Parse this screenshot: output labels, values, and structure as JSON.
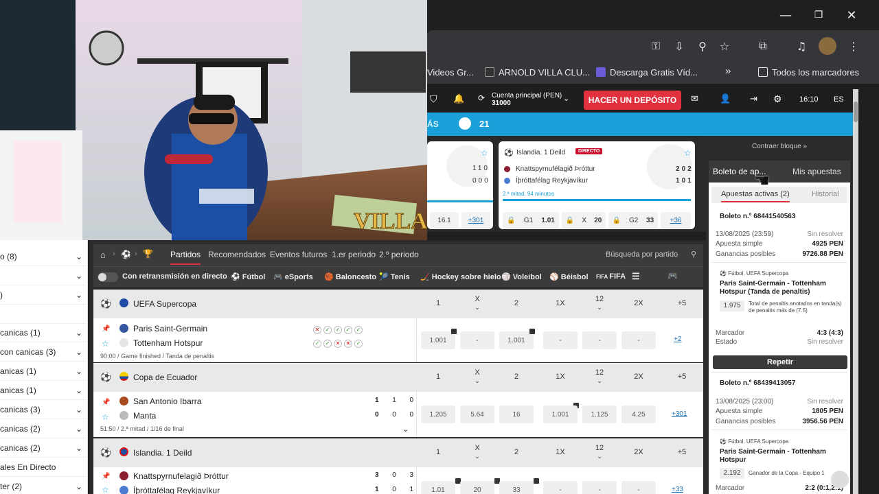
{
  "window": {
    "minimize": "—",
    "restore": "❐",
    "close": "✕"
  },
  "bookmarks": [
    {
      "label": "Videos Gr..."
    },
    {
      "label": "ARNOLD VILLA CLU..."
    },
    {
      "label": "Descarga Gratis Víd..."
    },
    {
      "label": "»"
    },
    {
      "label": "Todos los marcadores"
    }
  ],
  "site_header": {
    "account_label": "Cuenta principal (PEN)",
    "account_value": "31000",
    "deposit_button": "HACER UN DEPÓSITO",
    "time": "16:10",
    "lang": "ES"
  },
  "sports_bar": {
    "more": "ÁS",
    "count": "21"
  },
  "cards": [
    {
      "score_rows": [
        [
          "1",
          "1",
          "0"
        ],
        [
          "0",
          "0",
          "0"
        ]
      ],
      "odds": [
        "16.1",
        "+301"
      ]
    },
    {
      "league": "Islandia. 1 Deild",
      "live_badge": "DIRECTO",
      "team1": "Knattspyrnufélagið Þróttur",
      "team2": "Íþróttafélag Reykjavíkur",
      "score_rows": [
        [
          "2",
          "0",
          "2"
        ],
        [
          "1",
          "0",
          "1"
        ]
      ],
      "status": "2.ª mitad, 94 minutos",
      "odds": [
        {
          "k": "G1",
          "v": "1.01"
        },
        {
          "k": "X",
          "v": "20"
        },
        {
          "k": "G2",
          "v": "33"
        }
      ],
      "more": "+36"
    }
  ],
  "right_panel": {
    "collapse": "Contraer bloque »",
    "tab_slip": "Boleto de ap...",
    "tab_mybets": "Mis apuestas",
    "sub_active": "Apuestas activas (2)",
    "sub_history": "Historial",
    "tickets": [
      {
        "title": "Boleto n.º 68441540563",
        "date": "13/08/2025 (23:59)",
        "status": "Sin resolver",
        "type_label": "Apuesta simple",
        "stake": "4925 PEN",
        "gain_label": "Ganancias posibles",
        "gain": "9726.88 PEN",
        "sport": "Fútbol. UEFA Supercopa",
        "event": "Paris Saint-Germain - Tottenham Hotspur (Tanda de penaltis)",
        "odd": "1.975",
        "selection": "Total de penaltis anotados en tanda(s) de penaltis más de (7.5)",
        "score_label": "Marcador",
        "score": "4:3 (4:3)",
        "state_label": "Estado",
        "state": "Sin resolver",
        "repeat": "Repetir"
      },
      {
        "title": "Boleto n.º 68439413057",
        "date": "13/08/2025 (23:00)",
        "status": "Sin resolver",
        "type_label": "Apuesta simple",
        "stake": "1805 PEN",
        "gain_label": "Ganancias posibles",
        "gain": "3956.56 PEN",
        "sport": "Fútbol. UEFA Supercopa",
        "event": "Paris Saint-Germain - Tottenham Hotspur",
        "odd": "2.192",
        "selection": "Ganador de la Copa - Equipo 1",
        "score_label": "Marcador",
        "score": "2:2 (0:1,2:1)"
      }
    ]
  },
  "sidebar": [
    {
      "label": "o (8)"
    },
    {
      "label": ""
    },
    {
      "label": ")"
    },
    {
      "label": ""
    },
    {
      "label": " canicas (1)"
    },
    {
      "label": " con canicas (3)"
    },
    {
      "label": "anicas (1)"
    },
    {
      "label": "anicas (1)"
    },
    {
      "label": "canicas (3)"
    },
    {
      "label": "canicas (2)"
    },
    {
      "label": " canicas (2)"
    },
    {
      "label": "ales En Directo"
    },
    {
      "label": "ter (2)"
    }
  ],
  "tabs": {
    "active": "Partidos",
    "items": [
      "Recomendados",
      "Eventos futuros",
      "1.er periodo",
      "2.º periodo"
    ],
    "search_placeholder": "Búsqueda por partido"
  },
  "sports_filter": {
    "live_toggle": "Con retransmisión en directo",
    "items": [
      "Fútbol",
      "eSports",
      "Baloncesto",
      "Tenis",
      "Hockey sobre hielo",
      "Voleibol",
      "Béisbol",
      "FIFA"
    ]
  },
  "columns": [
    "1",
    "X",
    "2",
    "1X",
    "12",
    "2X",
    "+5"
  ],
  "leagues": [
    {
      "name": "UEFA Supercopa",
      "team1": "Paris Saint-Germain",
      "team2": "Tottenham Hotspur",
      "info": "90:00 / Game finished / Tanda de penaltis",
      "odds": [
        "1.001",
        "-",
        "1.001",
        "-",
        "-",
        "-"
      ],
      "more": "+2"
    },
    {
      "name": "Copa de Ecuador",
      "team1": "San Antonio Ibarra",
      "team2": "Manta",
      "score1": [
        "1",
        "1",
        "0"
      ],
      "score2": [
        "0",
        "0",
        "0"
      ],
      "info": "51:50 / 2.ª mitad / 1/16 de final",
      "odds": [
        "1.205",
        "5.64",
        "16",
        "1.001",
        "1.125",
        "4.25"
      ],
      "more": "+301"
    },
    {
      "name": "Islandia. 1 Deild",
      "team1": "Knattspyrnufelagið Þróttur",
      "team2": "Íþróttafélag Reykjavíkur",
      "score1": [
        "3",
        "0",
        "3"
      ],
      "score2": [
        "1",
        "0",
        "1"
      ],
      "odds": [
        "1.01",
        "20",
        "33",
        "-",
        "-",
        "-"
      ],
      "more": "+33"
    }
  ],
  "webcam": {
    "overlay_text": "VILLA"
  }
}
